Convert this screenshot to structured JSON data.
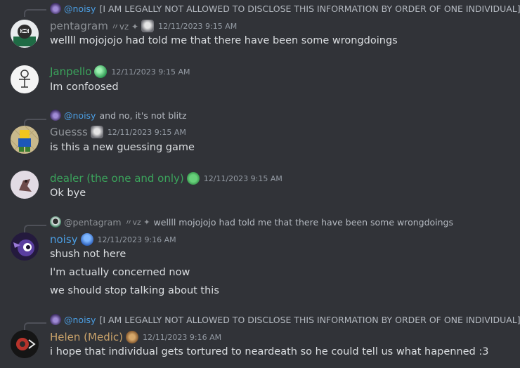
{
  "colors": {
    "background": "#313338",
    "mention": "#4b9ee3",
    "janpello": "#3ba55c",
    "dealer": "#3ba55c",
    "noisy": "#4b9ee3",
    "helen": "#c9a26a",
    "gray_name": "#8e9297"
  },
  "messages": [
    {
      "reply": {
        "name": "@noisy",
        "text": "[I AM LEGALLY NOT ALLOWED TO DISCLOSE THIS INFORMATION BY ORDER OF ONE INDIVIDUAL]"
      },
      "author": "pentagram",
      "tag": "〃vz ✦",
      "badge_icon": "hood-figure-icon",
      "timestamp": "12/11/2023 9:15 AM",
      "lines": [
        "wellll mojojojo had told me that there have been some wrongdoings"
      ]
    },
    {
      "author": "Janpello",
      "badge_icon": "green-orb-icon",
      "timestamp": "12/11/2023 9:15 AM",
      "lines": [
        "Im confoosed"
      ]
    },
    {
      "reply": {
        "name": "@noisy",
        "text": "and no, it's not blitz"
      },
      "author": "Guesss",
      "badge_icon": "hood-figure-icon",
      "timestamp": "12/11/2023 9:15 AM",
      "lines": [
        "is this a new guessing game"
      ]
    },
    {
      "author": "dealer (the one and only)",
      "badge_icon": "frog-icon",
      "timestamp": "12/11/2023 9:15 AM",
      "lines": [
        "Ok bye"
      ]
    },
    {
      "reply": {
        "name": "@pentagram",
        "tag": "〃vz ✦",
        "text": "wellll mojojojo had told me that there have been some wrongdoings"
      },
      "author": "noisy",
      "badge_icon": "blue-mushroom-icon",
      "timestamp": "12/11/2023 9:16 AM",
      "lines": [
        "shush not here",
        "I'm actually concerned now",
        "we should stop talking about this"
      ]
    },
    {
      "reply": {
        "name": "@noisy",
        "text": "[I AM LEGALLY NOT ALLOWED TO DISCLOSE THIS INFORMATION BY ORDER OF ONE INDIVIDUAL]"
      },
      "author": "Helen (Medic)",
      "badge_icon": "swirl-icon",
      "timestamp": "12/11/2023 9:16 AM",
      "lines": [
        "i hope that individual gets tortured to neardeath so he could tell us what hapenned :3"
      ]
    }
  ]
}
